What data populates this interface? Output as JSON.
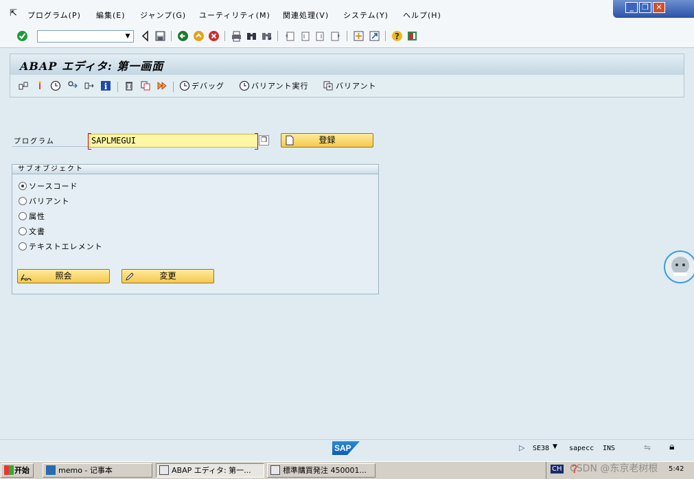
{
  "menubar": {
    "items": [
      "プログラム(P)",
      "編集(E)",
      "ジャンプ(G)",
      "ユーティリティ(M)",
      "関連処理(V)",
      "システム(Y)",
      "ヘルプ(H)"
    ]
  },
  "window_controls": {
    "minimize": "_",
    "restore": "❐",
    "close": "✕"
  },
  "toolbar": {
    "command_field_value": "",
    "icons": [
      "enter-icon",
      "back-icon",
      "save-icon",
      "back-arrow-icon",
      "exit-icon",
      "cancel-icon",
      "print-icon",
      "find-icon",
      "find-next-icon",
      "first-page-icon",
      "prev-page-icon",
      "next-page-icon",
      "last-page-icon",
      "create-session-icon",
      "shortcut-icon",
      "help-icon",
      "layout-icon"
    ]
  },
  "screen": {
    "title": "ABAP エディタ: 第一画面",
    "app_toolbar": {
      "debug_label": "デバッグ",
      "variant_run_label": "バリアント実行",
      "variant_label": "バリアント"
    }
  },
  "program": {
    "label": "プログラム",
    "value": "SAPLMEGUI",
    "register_button": "登録"
  },
  "subobject": {
    "title": "サブオブジェクト",
    "options": [
      "ソースコード",
      "バリアント",
      "属性",
      "文書",
      "テキストエレメント"
    ],
    "selected_index": 0,
    "display_button": "照会",
    "change_button": "変更"
  },
  "status": {
    "logo": "SAP",
    "transaction": "SE38",
    "system": "sapecc",
    "mode": "INS"
  },
  "taskbar": {
    "start": "开始",
    "tasks": [
      "memo - 记事本",
      "ABAP エディタ: 第一...",
      "標準購買発注 450001..."
    ],
    "lang": "CH",
    "watermark": "CSDN @东京老树根",
    "clock": "5:42"
  }
}
